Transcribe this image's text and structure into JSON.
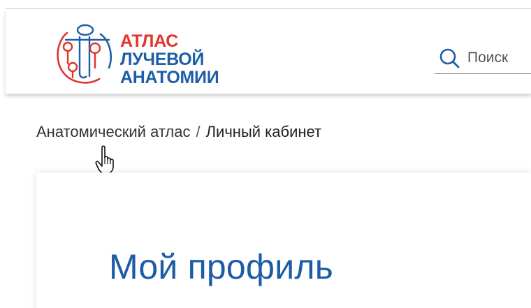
{
  "header": {
    "logo": {
      "line1": "АТЛАС",
      "line2": "ЛУЧЕВОЙ",
      "line3": "АНАТОМИИ",
      "colors": {
        "red": "#e2342b",
        "blue": "#1e5ea6"
      }
    },
    "search": {
      "icon": "search-icon",
      "placeholder": "Поиск"
    }
  },
  "breadcrumb": {
    "link": "Анатомический атлас",
    "separator": "/",
    "current": "Личный кабинет"
  },
  "profile": {
    "title": "Мой профиль",
    "title_color": "#1c5ca7"
  },
  "cursor": "hand-pointer-cursor"
}
